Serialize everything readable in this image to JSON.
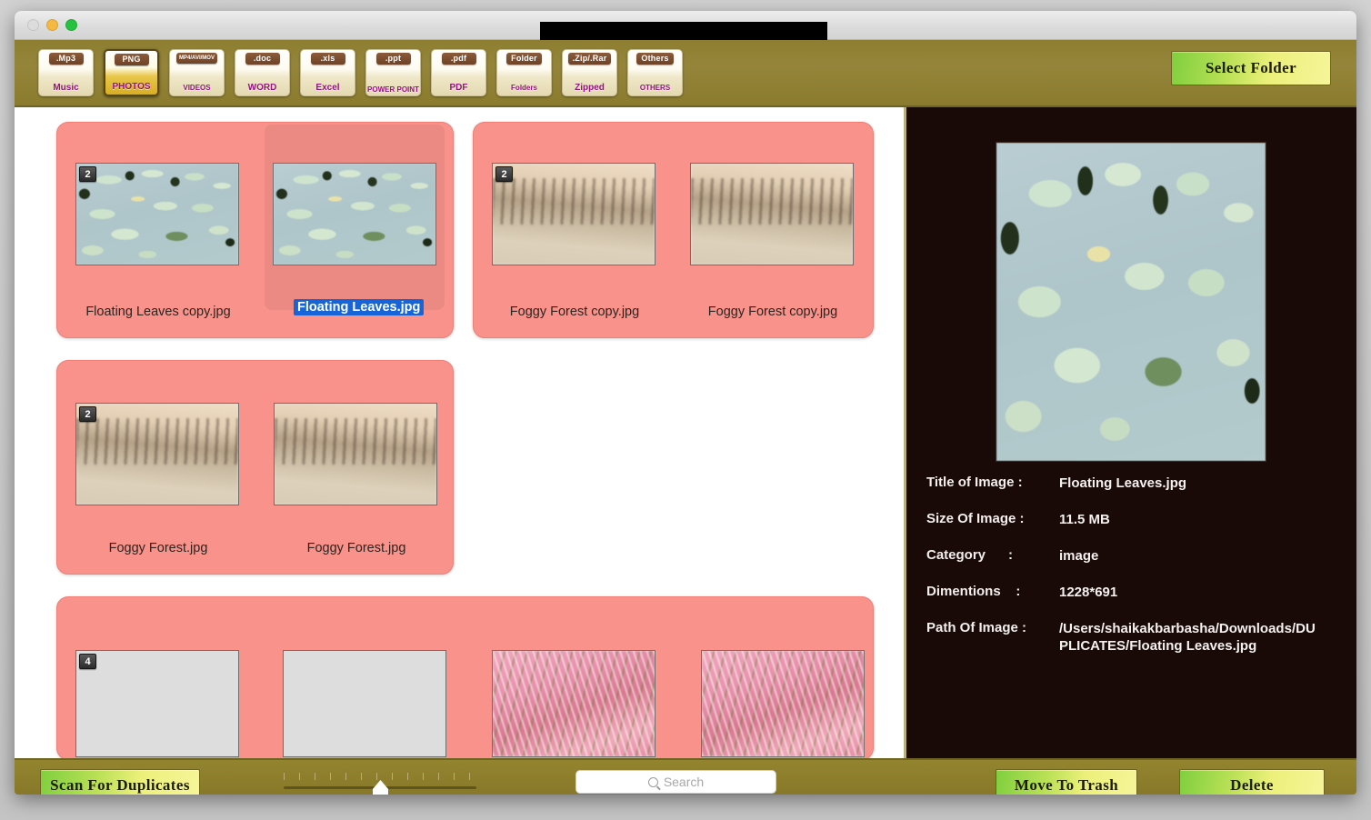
{
  "window": {
    "title_redacted": true,
    "traffic_lights": [
      "close-disabled",
      "minimize",
      "zoom"
    ]
  },
  "toolbar": {
    "categories": [
      {
        "ext": ".Mp3",
        "name": "Music",
        "active": false,
        "icon": "music-file-icon"
      },
      {
        "ext": "PNG",
        "name": "PHOTOS",
        "active": true,
        "icon": "photo-file-icon"
      },
      {
        "ext": "MP4/AVI/MOV",
        "name": "VIDEOS",
        "active": false,
        "icon": "video-file-icon"
      },
      {
        "ext": ".doc",
        "name": "WORD",
        "active": false,
        "icon": "word-file-icon"
      },
      {
        "ext": ".xls",
        "name": "Excel",
        "active": false,
        "icon": "excel-file-icon"
      },
      {
        "ext": ".ppt",
        "name": "POWER POINT",
        "active": false,
        "icon": "powerpoint-file-icon"
      },
      {
        "ext": ".pdf",
        "name": "PDF",
        "active": false,
        "icon": "pdf-file-icon"
      },
      {
        "ext": "Folder",
        "name": "Folders",
        "active": false,
        "icon": "folder-icon"
      },
      {
        "ext": ".Zip/.Rar",
        "name": "Zipped",
        "active": false,
        "icon": "zip-file-icon"
      },
      {
        "ext": "Others",
        "name": "OTHERS",
        "active": false,
        "icon": "others-file-icon"
      }
    ],
    "select_folder_label": "Select Folder"
  },
  "groups": [
    {
      "badge": "2",
      "art": "lily",
      "items": [
        {
          "label": "Floating Leaves copy.jpg",
          "selected": false
        },
        {
          "label": "Floating Leaves.jpg",
          "selected": true
        }
      ]
    },
    {
      "badge": "2",
      "art": "fog",
      "items": [
        {
          "label": "Foggy Forest copy.jpg",
          "selected": false
        },
        {
          "label": "Foggy Forest copy.jpg",
          "selected": false
        }
      ]
    },
    {
      "badge": "2",
      "art": "fog",
      "items": [
        {
          "label": "Foggy Forest.jpg",
          "selected": false
        },
        {
          "label": "Foggy Forest.jpg",
          "selected": false
        }
      ]
    },
    {
      "badge": "4",
      "art": "mixed",
      "items": [
        {
          "label": "",
          "selected": false
        },
        {
          "label": "",
          "selected": false
        },
        {
          "label": "",
          "selected": false
        },
        {
          "label": "",
          "selected": false
        }
      ]
    }
  ],
  "info": {
    "preview_alt": "Floating Leaves.jpg preview",
    "rows": [
      {
        "label": "Title of Image :",
        "value": "Floating Leaves.jpg"
      },
      {
        "label": "Size Of Image :",
        "value": "11.5 MB"
      },
      {
        "label": "Category      :",
        "value": "image"
      },
      {
        "label": "Dimentions    :",
        "value": "1228*691"
      },
      {
        "label": "Path Of Image :",
        "value": "/Users/shaikakbarbasha/Downloads/DUPLICATES/Floating Leaves.jpg"
      }
    ]
  },
  "bottom": {
    "scan_label": "Scan For Duplicates",
    "move_label": "Move To Trash",
    "delete_label": "Delete",
    "search_placeholder": "Search",
    "search_value": "",
    "slider_position_pct": 46
  },
  "colors": {
    "chrome_gold": "#8a7b2e",
    "group_pink": "#f8928a",
    "button_green_yellow": "#b9e055",
    "selection_blue": "#1565d8",
    "info_panel_dark": "#190a07"
  }
}
